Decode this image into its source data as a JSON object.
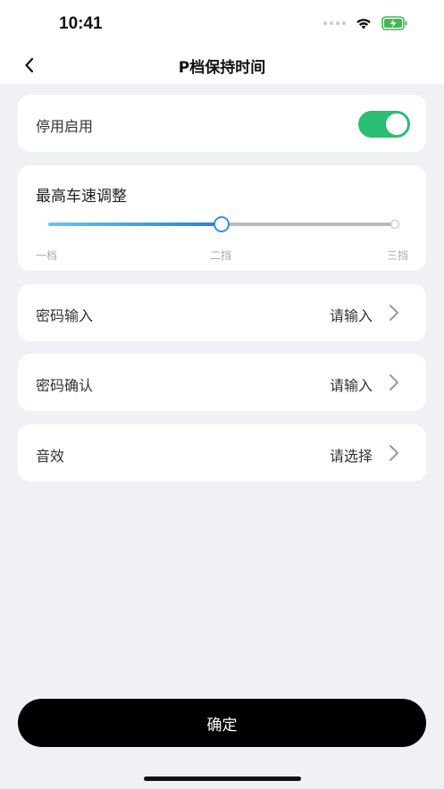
{
  "status_bar": {
    "time": "10:41",
    "icons": [
      "cellular-dots-icon",
      "wifi-icon",
      "battery-charging-icon"
    ],
    "battery_color": "#3fb950"
  },
  "nav": {
    "back_icon": "chevron-left-icon",
    "title": "P档保持时间"
  },
  "toggle_row": {
    "label": "停用启用",
    "enabled": true,
    "color": "#2bbd74"
  },
  "slider": {
    "title": "最高车速调整",
    "ticks": [
      "一档",
      "二挡",
      "三挡"
    ],
    "value_fraction": 0.5
  },
  "rows": [
    {
      "label": "密码输入",
      "value": "请输入"
    },
    {
      "label": "密码确认",
      "value": "请输入"
    },
    {
      "label": "音效",
      "value": "请选择"
    }
  ],
  "confirm": {
    "label": "确定"
  }
}
